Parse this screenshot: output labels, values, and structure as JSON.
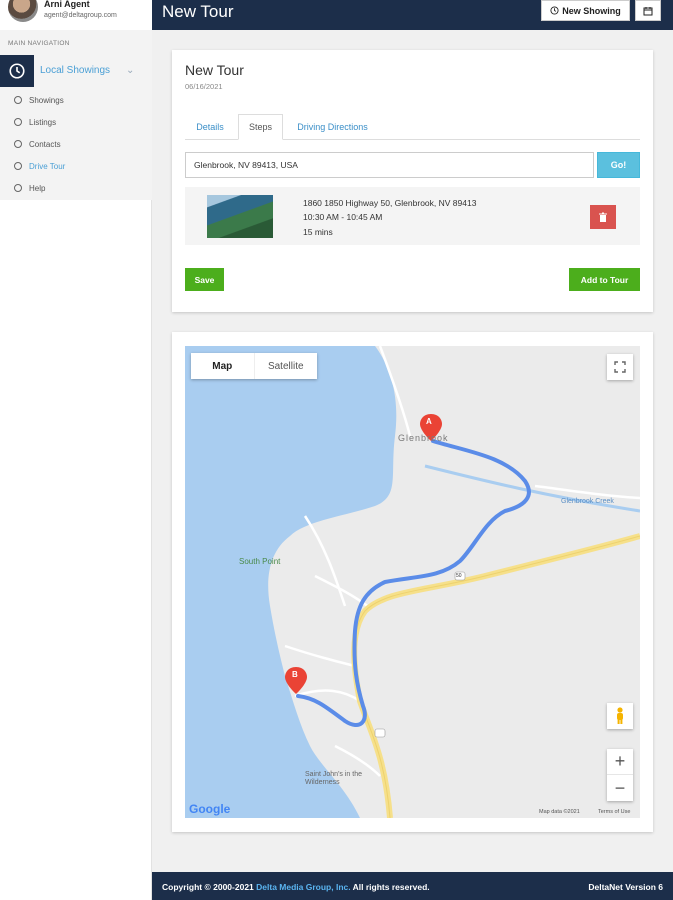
{
  "user": {
    "name": "Arni Agent",
    "email": "agent@deltagroup.com"
  },
  "sidebar": {
    "heading": "MAIN NAVIGATION",
    "group": {
      "label": "Local Showings",
      "icon": "clock-icon"
    },
    "items": [
      {
        "label": "Showings"
      },
      {
        "label": "Listings"
      },
      {
        "label": "Contacts"
      },
      {
        "label": "Drive Tour",
        "active": true
      },
      {
        "label": "Help"
      }
    ]
  },
  "header": {
    "title": "New Tour",
    "new_showing_label": "New Showing",
    "calendar_icon": "calendar-icon"
  },
  "tour": {
    "title": "New Tour",
    "date": "06/16/2021",
    "tabs": [
      {
        "label": "Details"
      },
      {
        "label": "Steps",
        "active": true
      },
      {
        "label": "Driving Directions"
      }
    ],
    "address_value": "Glenbrook, NV 89413, USA",
    "go_label": "Go!",
    "step": {
      "address": "1860 1850 Highway 50, Glenbrook, NV 89413",
      "time": "10:30 AM - 10:45 AM",
      "duration": "15 mins"
    },
    "save_label": "Save",
    "add_label": "Add to Tour"
  },
  "map": {
    "type_map": "Map",
    "type_satellite": "Satellite",
    "labels": {
      "glenbrook": "Glenbrook",
      "creek": "Glenbrook Creek",
      "south_point": "South Point",
      "church": "Saint John's in the Wilderness"
    },
    "marker_a": "A",
    "marker_b": "B",
    "route_number": "50",
    "zoom_in": "+",
    "zoom_out": "−",
    "google": "Google",
    "map_data": "Map data ©2021",
    "terms": "Terms of Use"
  },
  "footer": {
    "copy_prefix": "Copyright © 2000-2021 ",
    "company": "Delta Media Group, Inc.",
    "copy_suffix": " All rights reserved.",
    "version": "DeltaNet Version 6"
  },
  "colors": {
    "navy": "#1c2e4a",
    "accent": "#4a9fd5",
    "green": "#4cae1c",
    "info": "#5bc0de",
    "danger": "#d9534f"
  }
}
